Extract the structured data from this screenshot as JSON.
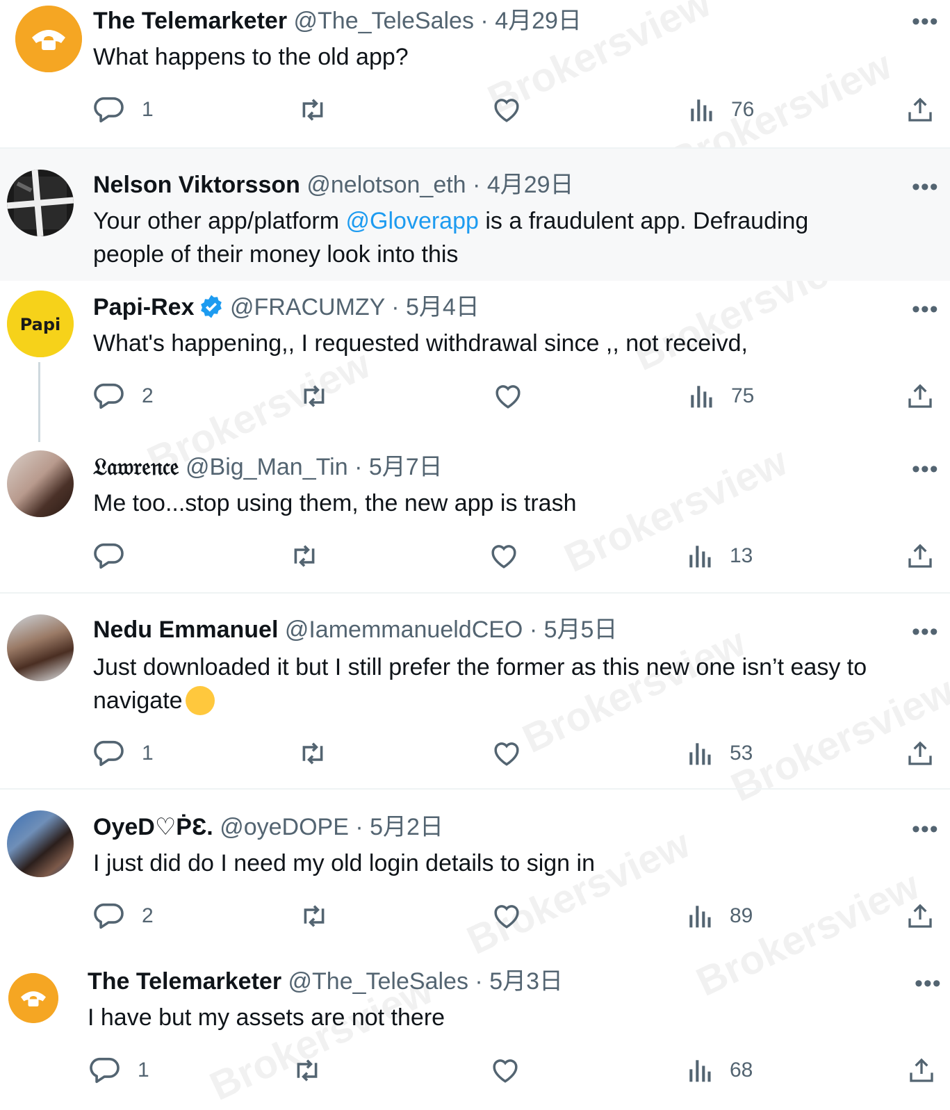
{
  "watermark": "Brokersview",
  "tweets": [
    {
      "name": "The Telemarketer",
      "handle": "@The_TeleSales",
      "separator": "·",
      "date": "4月29日",
      "text": "What happens to the old app?",
      "reply_count": "1",
      "retweet_count": "",
      "like_count": "",
      "views": "76",
      "more": "•••"
    },
    {
      "name": "Nelson Viktorsson",
      "handle": "@nelotson_eth",
      "separator": "·",
      "date": "4月29日",
      "text_before": "Your other app/platform ",
      "mention": "@Gloverapp",
      "text_after": " is a fraudulent app. Defrauding people of their money look into this",
      "more": "•••"
    },
    {
      "name": "Papi-Rex",
      "avatar_label": "Papi",
      "handle": "@FRACUMZY",
      "separator": "·",
      "date": "5月4日",
      "text": "What's happening,, I requested withdrawal since ,, not receivd,",
      "reply_count": "2",
      "views": "75",
      "more": "•••"
    },
    {
      "name": "𝔏𝔞𝔴𝔯𝔢𝔫𝔠𝔢",
      "handle": "@Big_Man_Tin",
      "separator": "·",
      "date": "5月7日",
      "text": "Me too...stop using them, the new app is trash",
      "reply_count": "",
      "views": "13",
      "more": "•••"
    },
    {
      "name": "Nedu Emmanuel",
      "handle": "@IamemmanueldCEO",
      "separator": "·",
      "date": "5月5日",
      "text": "Just downloaded it but I still prefer the former as this new one isn’t easy to navigate",
      "emoji": "thinking-face",
      "reply_count": "1",
      "views": "53",
      "more": "•••"
    },
    {
      "name": "OyeD♡ṖƐ.",
      "handle": "@oyeDOPE",
      "separator": "·",
      "date": "5月2日",
      "text": "I just did do I need my old login details to sign in",
      "reply_count": "2",
      "views": "89",
      "more": "•••"
    },
    {
      "name": "The Telemarketer",
      "handle": "@The_TeleSales",
      "separator": "·",
      "date": "5月3日",
      "text": "I have but my assets are not there",
      "reply_count": "1",
      "views": "68",
      "more": "•••"
    }
  ],
  "colors": {
    "text": "#0f1419",
    "secondary": "#536471",
    "accent": "#1d9bf0",
    "divider": "#eff3f4"
  }
}
